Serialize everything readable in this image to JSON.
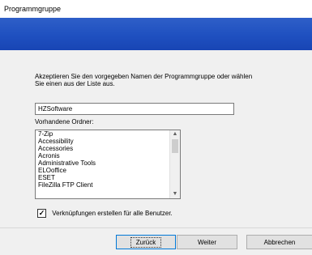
{
  "window": {
    "title": "Programmgruppe"
  },
  "banner": {
    "color": "#2456c4"
  },
  "description": {
    "line1": "Akzeptieren Sie den vorgegeben Namen der Programmgruppe oder wählen",
    "line2": "Sie einen aus der Liste aus."
  },
  "group_name": {
    "value": "HZSoftware"
  },
  "folders": {
    "label": "Vorhandene Ordner:",
    "items": [
      "7-Zip",
      "Accessibility",
      "Accessories",
      "Acronis",
      "Administrative Tools",
      "ELOoffice",
      "ESET",
      "FileZilla FTP Client"
    ]
  },
  "all_users": {
    "checked": true,
    "label": "Verknüpfungen erstellen für alle Benutzer."
  },
  "buttons": {
    "back": "Zurück",
    "next": "Weiter",
    "cancel": "Abbrechen"
  }
}
